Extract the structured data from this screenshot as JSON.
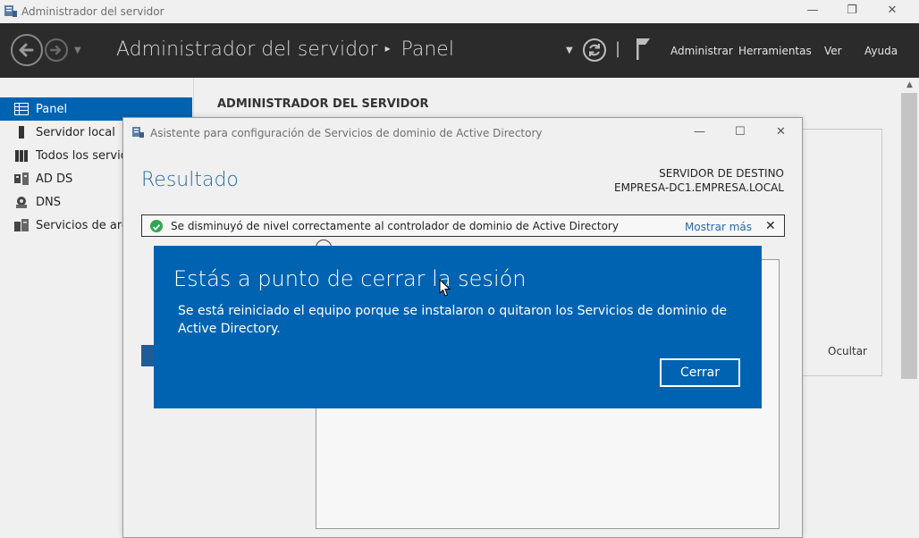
{
  "window": {
    "title": "Administrador del servidor",
    "controls": {
      "minimize": "—",
      "maximize": "❐",
      "close": "✕"
    }
  },
  "header": {
    "breadcrumb_root": "Administrador del servidor",
    "breadcrumb_separator": "▸",
    "breadcrumb_current": "Panel",
    "menu": {
      "administrar": "Administrar",
      "herramientas": "Herramientas",
      "ver": "Ver",
      "ayuda": "Ayuda"
    },
    "icons": [
      "back-arrow-icon",
      "forward-arrow-icon",
      "refresh-icon",
      "flag-icon"
    ]
  },
  "sidebar": {
    "items": [
      {
        "label": "Panel",
        "icon": "dashboard-icon",
        "selected": true
      },
      {
        "label": "Servidor local",
        "icon": "server-icon",
        "selected": false
      },
      {
        "label": "Todos los servid",
        "icon": "servers-icon",
        "selected": false
      },
      {
        "label": "AD DS",
        "icon": "ad-ds-icon",
        "selected": false
      },
      {
        "label": "DNS",
        "icon": "dns-icon",
        "selected": false
      },
      {
        "label": "Servicios de arch",
        "icon": "file-services-icon",
        "selected": false
      }
    ]
  },
  "main": {
    "heading": "ADMINISTRADOR DEL SERVIDOR",
    "hide_label": "Ocultar"
  },
  "wizard": {
    "title": "Asistente para configuración de Servicios de dominio de Active Directory",
    "heading": "Resultado",
    "destination_label": "SERVIDOR DE DESTINO",
    "destination_value": "EMPRESA-DC1.EMPRESA.LOCAL",
    "status_text": "Se disminuyó de nivel correctamente al controlador de dominio de Active Directory",
    "status_more": "Mostrar más",
    "status_close": "✕",
    "controls": {
      "minimize": "—",
      "maximize": "☐",
      "close": "✕"
    }
  },
  "toast": {
    "title": "Estás a punto de cerrar la sesión",
    "message": "Se está reiniciado el equipo porque se instalaron o quitaron los Servicios de dominio de Active Directory.",
    "button": "Cerrar"
  },
  "colors": {
    "accent": "#0063b1",
    "header_bg": "#2b2b2b",
    "success": "#2fa84f"
  }
}
